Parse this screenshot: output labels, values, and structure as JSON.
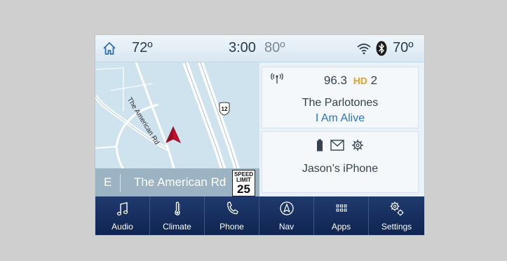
{
  "status_bar": {
    "home_icon": "home-icon",
    "left_temp": "72º",
    "time": "3:00",
    "outside_temp": "80º",
    "right_temp": "70º",
    "wifi_icon": "wifi-icon",
    "bluetooth_icon": "bluetooth-icon"
  },
  "map": {
    "road_label": "The American Rd",
    "route_shield": "12",
    "heading": "E",
    "street_name": "The American Rd",
    "speed_limit": {
      "line1": "SPEED",
      "line2": "LIMIT",
      "value": "25"
    }
  },
  "audio_card": {
    "signal_icon": "radio-signal-icon",
    "frequency": "96.3",
    "hd_label": "HD",
    "hd_channel": "2",
    "artist": "The Parlotones",
    "song": "I Am Alive"
  },
  "phone_card": {
    "icons": [
      "battery-icon",
      "message-icon",
      "settings-gear-icon"
    ],
    "device": "Jason’s iPhone"
  },
  "nav_bar": {
    "items": [
      {
        "label": "Audio",
        "icon": "music-note-icon"
      },
      {
        "label": "Climate",
        "icon": "thermometer-icon"
      },
      {
        "label": "Phone",
        "icon": "phone-icon"
      },
      {
        "label": "Nav",
        "icon": "navigation-icon"
      },
      {
        "label": "Apps",
        "icon": "apps-grid-icon"
      },
      {
        "label": "Settings",
        "icon": "gears-icon"
      }
    ]
  },
  "colors": {
    "nav_bar": "#1a3263",
    "song_title": "#2b76c0",
    "hd_badge": "#e9a020",
    "map_water": "#cfe3ee",
    "vehicle_arrow": "#c8102e"
  }
}
